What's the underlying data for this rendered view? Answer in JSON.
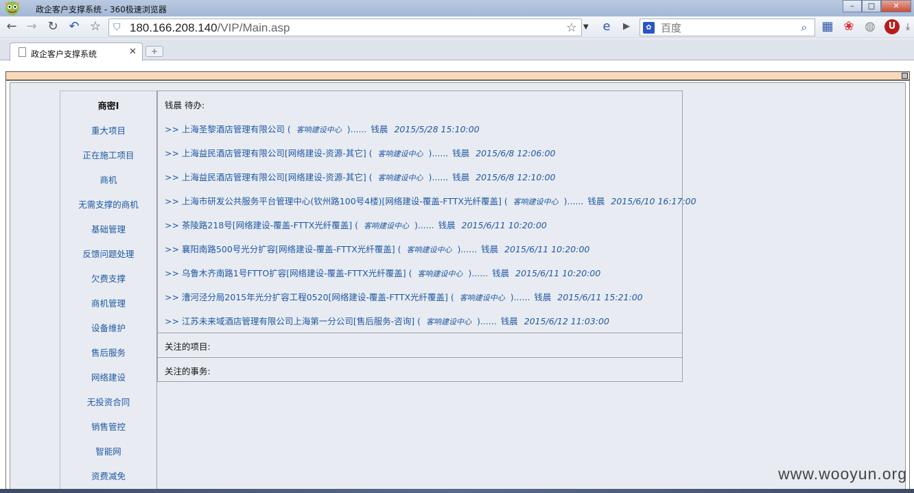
{
  "window": {
    "title": "政企客户支撑系统 - 360极速浏览器",
    "minimize": "–",
    "maximize": "□",
    "close": "✕"
  },
  "toolbar": {
    "url_host": "180.166.208.140",
    "url_path": "/VIP/Main.asp",
    "search_placeholder": "百度"
  },
  "tab": {
    "title": "政企客户支撑系统",
    "new_tab": "+"
  },
  "sidebar": {
    "title": "商密I",
    "items": [
      "重大项目",
      "正在施工项目",
      "商机",
      "无需支撑的商机",
      "基础管理",
      "反馈问题处理",
      "欠费支撑",
      "商机管理",
      "设备维护",
      "售后服务",
      "网络建设",
      "无投资合同",
      "销售管控",
      "智能网",
      "资费减免"
    ]
  },
  "todo": {
    "heading": "钱晨  待办:",
    "tasks": [
      {
        "name": ">> 上海圣黎酒店管理有限公司",
        "dept": "客响建设中心",
        "owner": "钱晨",
        "time": "2015/5/28 15:10:00"
      },
      {
        "name": ">> 上海益民酒店管理有限公司[网络建设-资源-其它]",
        "dept": "客响建设中心",
        "owner": "钱晨",
        "time": "2015/6/8 12:06:00"
      },
      {
        "name": ">> 上海益民酒店管理有限公司[网络建设-资源-其它]",
        "dept": "客响建设中心",
        "owner": "钱晨",
        "time": "2015/6/8 12:10:00"
      },
      {
        "name": ">> 上海市研发公共服务平台管理中心(钦州路100号4楼)[网络建设-覆盖-FTTX光纤覆盖]",
        "dept": "客响建设中心",
        "owner": "钱晨",
        "time": "2015/6/10 16:17:00"
      },
      {
        "name": ">> 茶陵路218号[网络建设-覆盖-FTTX光纤覆盖]",
        "dept": "客响建设中心",
        "owner": "钱晨",
        "time": "2015/6/11 10:20:00"
      },
      {
        "name": ">> 襄阳南路500号光分扩容[网络建设-覆盖-FTTX光纤覆盖]",
        "dept": "客响建设中心",
        "owner": "钱晨",
        "time": "2015/6/11 10:20:00"
      },
      {
        "name": ">> 乌鲁木齐南路1号FTTO扩容[网络建设-覆盖-FTTX光纤覆盖]",
        "dept": "客响建设中心",
        "owner": "钱晨",
        "time": "2015/6/11 10:20:00"
      },
      {
        "name": ">> 漕河泾分局2015年光分扩容工程0520[网络建设-覆盖-FTTX光纤覆盖]",
        "dept": "客响建设中心",
        "owner": "钱晨",
        "time": "2015/6/11 15:21:00"
      },
      {
        "name": ">> 江苏未来域酒店管理有限公司上海第一分公司[售后服务-咨询]",
        "dept": "客响建设中心",
        "owner": "钱晨",
        "time": "2015/6/12 11:03:00"
      }
    ]
  },
  "followed_projects": "关注的项目:",
  "followed_affairs": "关注的事务:",
  "watermark": "www.wooyun.org"
}
